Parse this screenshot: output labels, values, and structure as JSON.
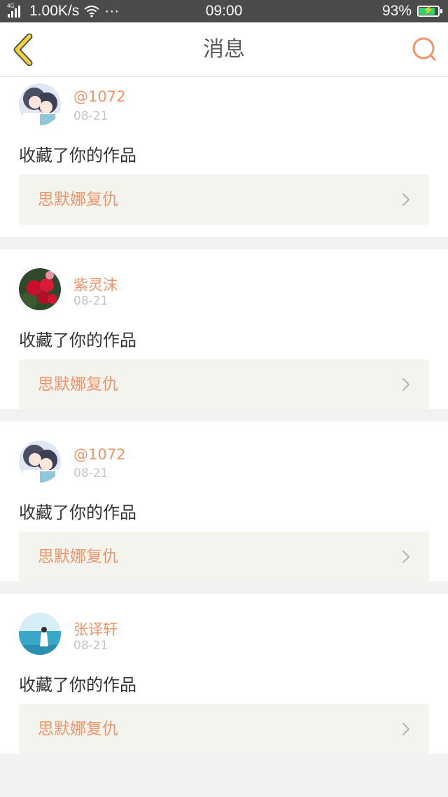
{
  "status_bar": {
    "network_type": "4G",
    "speed": "1.00K/s",
    "more": "···",
    "time": "09:00",
    "battery_percent": "93%",
    "battery_level": 0.93,
    "battery_color": "#2ed36b"
  },
  "header": {
    "title": "消息",
    "accent_color": "#f5d33c",
    "search_color": "#f0956a"
  },
  "notifications": [
    {
      "username": "@1072",
      "date": "08-21",
      "action": "收藏了你的作品",
      "work_title": "思默娜复仇",
      "avatar": "anime-couple-avatar"
    },
    {
      "username": "紫灵沫",
      "date": "08-21",
      "action": "收藏了你的作品",
      "work_title": "思默娜复仇",
      "avatar": "red-roses-avatar"
    },
    {
      "username": "@1072",
      "date": "08-21",
      "action": "收藏了你的作品",
      "work_title": "思默娜复仇",
      "avatar": "anime-couple-avatar"
    },
    {
      "username": "张译轩",
      "date": "08-21",
      "action": "收藏了你的作品",
      "work_title": "思默娜复仇",
      "avatar": "beach-girl-avatar"
    }
  ]
}
